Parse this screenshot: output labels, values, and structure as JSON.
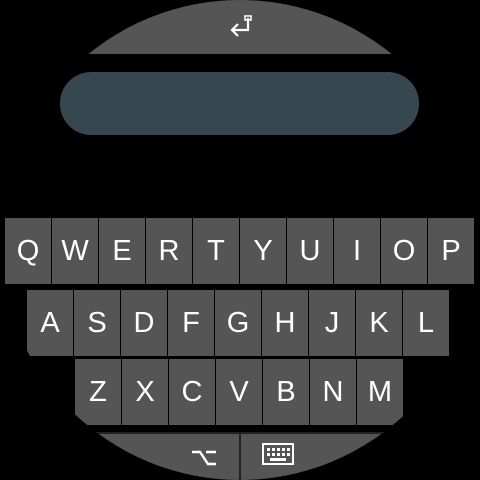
{
  "text_field": {
    "value": ""
  },
  "keyboard": {
    "row1": [
      "Q",
      "W",
      "E",
      "R",
      "T",
      "Y",
      "U",
      "I",
      "O",
      "P"
    ],
    "row2": [
      "A",
      "S",
      "D",
      "F",
      "G",
      "H",
      "J",
      "K",
      "L"
    ],
    "row3": [
      "Z",
      "X",
      "C",
      "V",
      "B",
      "N",
      "M"
    ]
  },
  "icons": {
    "enter": "enter-icon",
    "alt_symbols": "alt-symbols-icon",
    "keyboard": "keyboard-icon"
  },
  "colors": {
    "background": "#000000",
    "key": "#555555",
    "text_field": "#37474f",
    "text": "#ffffff"
  }
}
